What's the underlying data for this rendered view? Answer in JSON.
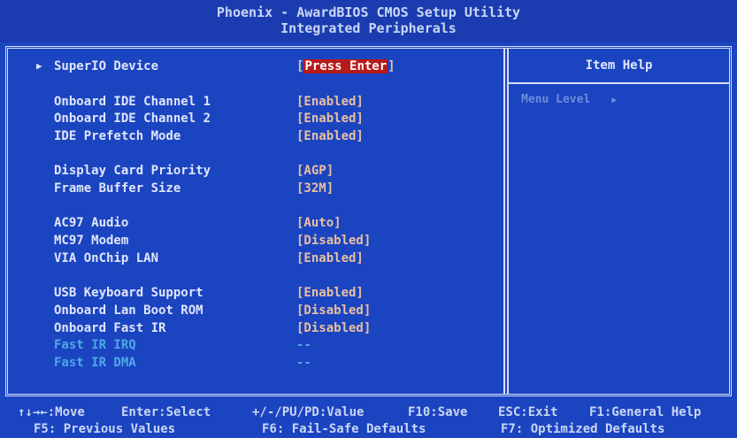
{
  "header": {
    "title": "Phoenix - AwardBIOS CMOS Setup Utility",
    "subtitle": "Integrated Peripherals"
  },
  "settings": [
    {
      "marker": "▶",
      "label": "SuperIO Device",
      "value_prefix": "[",
      "value": "Press Enter",
      "value_suffix": "]",
      "selected": true
    },
    {
      "label": "Onboard IDE Channel 1",
      "value": "[Enabled]"
    },
    {
      "label": "Onboard IDE Channel 2",
      "value": "[Enabled]"
    },
    {
      "label": "IDE Prefetch Mode",
      "value": "[Enabled]"
    },
    {
      "label": "Display Card Priority",
      "value": "[AGP]"
    },
    {
      "label": "Frame Buffer Size",
      "value": "[32M]"
    },
    {
      "label": "AC97 Audio",
      "value": "[Auto]"
    },
    {
      "label": "MC97 Modem",
      "value": "[Disabled]"
    },
    {
      "label": "VIA OnChip LAN",
      "value": "[Enabled]"
    },
    {
      "label": "USB Keyboard Support",
      "value": "[Enabled]"
    },
    {
      "label": "Onboard Lan Boot ROM",
      "value": "[Disabled]"
    },
    {
      "label": "Onboard Fast IR",
      "value": "[Disabled]"
    },
    {
      "label": "Fast IR IRQ",
      "value": "--",
      "dimmed": true
    },
    {
      "label": "Fast IR DMA",
      "value": "--",
      "dimmed": true
    }
  ],
  "help": {
    "header": "Item Help",
    "menu_level_label": "Menu Level",
    "menu_level_arrow": "▶"
  },
  "footer": {
    "line1": {
      "move": "↑↓→←:Move",
      "select": "Enter:Select",
      "value": "+/-/PU/PD:Value",
      "save": "F10:Save",
      "exit": "ESC:Exit",
      "help": "F1:General Help"
    },
    "line2": {
      "previous": "F5: Previous Values",
      "failsafe": "F6: Fail-Safe Defaults",
      "optimized": "F7: Optimized Defaults"
    }
  },
  "colors": {
    "background": "#1b44c0",
    "text": "#dfe6fb",
    "value": "#e8c0a0",
    "dimmed": "#4fa8e8",
    "selection": "#b81a1a"
  }
}
